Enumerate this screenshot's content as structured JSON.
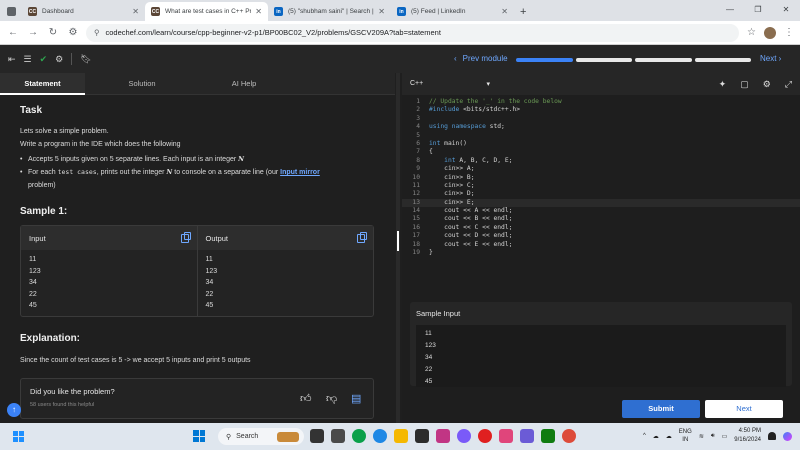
{
  "browser": {
    "tabs": [
      {
        "label": "Dashboard",
        "favicon": "CC",
        "color": "#5b4636",
        "active": false
      },
      {
        "label": "What are test cases in C++ Pro...",
        "favicon": "CC",
        "color": "#5b4636",
        "active": true
      },
      {
        "label": "(5) \"shubham saini\" | Search | L...",
        "favicon": "in",
        "color": "#0a66c2",
        "active": false
      },
      {
        "label": "(5) Feed | LinkedIn",
        "favicon": "in",
        "color": "#0a66c2",
        "active": false
      }
    ],
    "new_tab": "+",
    "url": "codechef.com/learn/course/cpp-beginner-v2-p1/BP00BC02_V2/problems/GSCV209A?tab=statement"
  },
  "header": {
    "prev_module": "Prev module",
    "next_module": "Next",
    "progress_done_fraction": 0.25
  },
  "left": {
    "tabs": [
      "Statement",
      "Solution",
      "AI Help"
    ],
    "task_heading": "Task",
    "intro": "Lets solve a simple problem.",
    "write": "Write a program in the IDE which does the following",
    "bullet1": {
      "a": "Accepts 5 inputs given on 5 separate lines. Each input is an integer ",
      "n": "N"
    },
    "bullet2": {
      "a": "For each ",
      "code": "test cases",
      "b": ", prints out the integer ",
      "n": "N",
      "c": " to console on a separate line (our ",
      "link": "Input mirror",
      "d": "problem)"
    },
    "sample_heading": "Sample 1:",
    "input_label": "Input",
    "output_label": "Output",
    "inputs": [
      "11",
      "123",
      "34",
      "22",
      "45"
    ],
    "outputs": [
      "11",
      "123",
      "34",
      "22",
      "45"
    ],
    "explanation_heading": "Explanation:",
    "explanation": "Since the count of test cases is 5 -> we accept 5 inputs and print 5 outputs",
    "like_question": "Did you like the problem?",
    "like_count": "58 users found this helpful"
  },
  "editor": {
    "language": "C++",
    "lines": [
      {
        "n": "1",
        "t": "// Update the '_' in the code below",
        "c": "cm"
      },
      {
        "n": "2",
        "t": "#include <bits/stdc++.h>",
        "c": ""
      },
      {
        "n": "3",
        "t": "",
        "c": ""
      },
      {
        "n": "4",
        "t": "using namespace std;",
        "c": ""
      },
      {
        "n": "5",
        "t": "",
        "c": ""
      },
      {
        "n": "6",
        "t": "int main()",
        "c": ""
      },
      {
        "n": "7",
        "t": "{",
        "c": ""
      },
      {
        "n": "8",
        "t": "    int A, B, C, D, E;",
        "c": ""
      },
      {
        "n": "9",
        "t": "    cin>> A;",
        "c": ""
      },
      {
        "n": "10",
        "t": "    cin>> B;",
        "c": ""
      },
      {
        "n": "11",
        "t": "    cin>> C;",
        "c": ""
      },
      {
        "n": "12",
        "t": "    cin>> D;",
        "c": ""
      },
      {
        "n": "13",
        "t": "    cin>> E;",
        "c": ""
      },
      {
        "n": "14",
        "t": "    cout << A << endl;",
        "c": ""
      },
      {
        "n": "15",
        "t": "    cout << B << endl;",
        "c": ""
      },
      {
        "n": "16",
        "t": "    cout << C << endl;",
        "c": ""
      },
      {
        "n": "17",
        "t": "    cout << D << endl;",
        "c": ""
      },
      {
        "n": "18",
        "t": "    cout << E << endl;",
        "c": ""
      },
      {
        "n": "19",
        "t": "}",
        "c": ""
      }
    ],
    "sample_input_label": "Sample Input",
    "sample_input": [
      "11",
      "123",
      "34",
      "22",
      "45"
    ],
    "submit": "Submit",
    "next": "Next"
  },
  "taskbar": {
    "search": "Search",
    "lang_top": "ENG",
    "lang_bottom": "IN",
    "time": "4:50 PM",
    "date": "9/16/2024"
  }
}
